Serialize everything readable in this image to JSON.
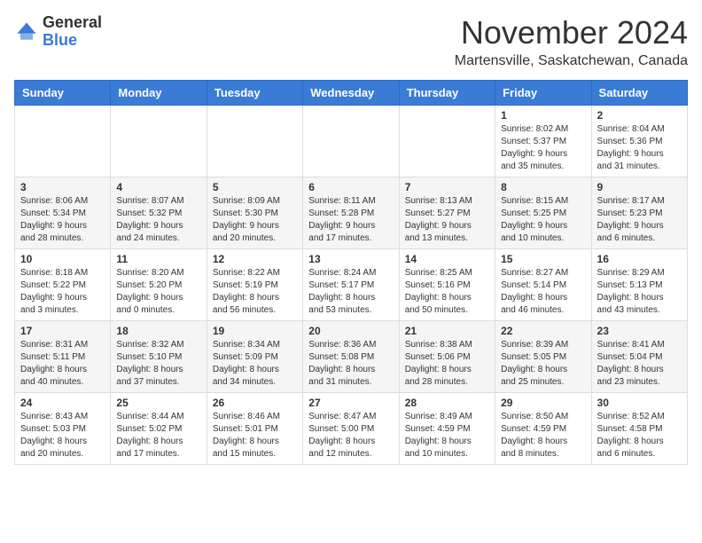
{
  "header": {
    "logo_general": "General",
    "logo_blue": "Blue",
    "month": "November 2024",
    "location": "Martensville, Saskatchewan, Canada"
  },
  "weekdays": [
    "Sunday",
    "Monday",
    "Tuesday",
    "Wednesday",
    "Thursday",
    "Friday",
    "Saturday"
  ],
  "weeks": [
    [
      {
        "day": "",
        "info": ""
      },
      {
        "day": "",
        "info": ""
      },
      {
        "day": "",
        "info": ""
      },
      {
        "day": "",
        "info": ""
      },
      {
        "day": "",
        "info": ""
      },
      {
        "day": "1",
        "info": "Sunrise: 8:02 AM\nSunset: 5:37 PM\nDaylight: 9 hours\nand 35 minutes."
      },
      {
        "day": "2",
        "info": "Sunrise: 8:04 AM\nSunset: 5:36 PM\nDaylight: 9 hours\nand 31 minutes."
      }
    ],
    [
      {
        "day": "3",
        "info": "Sunrise: 8:06 AM\nSunset: 5:34 PM\nDaylight: 9 hours\nand 28 minutes."
      },
      {
        "day": "4",
        "info": "Sunrise: 8:07 AM\nSunset: 5:32 PM\nDaylight: 9 hours\nand 24 minutes."
      },
      {
        "day": "5",
        "info": "Sunrise: 8:09 AM\nSunset: 5:30 PM\nDaylight: 9 hours\nand 20 minutes."
      },
      {
        "day": "6",
        "info": "Sunrise: 8:11 AM\nSunset: 5:28 PM\nDaylight: 9 hours\nand 17 minutes."
      },
      {
        "day": "7",
        "info": "Sunrise: 8:13 AM\nSunset: 5:27 PM\nDaylight: 9 hours\nand 13 minutes."
      },
      {
        "day": "8",
        "info": "Sunrise: 8:15 AM\nSunset: 5:25 PM\nDaylight: 9 hours\nand 10 minutes."
      },
      {
        "day": "9",
        "info": "Sunrise: 8:17 AM\nSunset: 5:23 PM\nDaylight: 9 hours\nand 6 minutes."
      }
    ],
    [
      {
        "day": "10",
        "info": "Sunrise: 8:18 AM\nSunset: 5:22 PM\nDaylight: 9 hours\nand 3 minutes."
      },
      {
        "day": "11",
        "info": "Sunrise: 8:20 AM\nSunset: 5:20 PM\nDaylight: 9 hours\nand 0 minutes."
      },
      {
        "day": "12",
        "info": "Sunrise: 8:22 AM\nSunset: 5:19 PM\nDaylight: 8 hours\nand 56 minutes."
      },
      {
        "day": "13",
        "info": "Sunrise: 8:24 AM\nSunset: 5:17 PM\nDaylight: 8 hours\nand 53 minutes."
      },
      {
        "day": "14",
        "info": "Sunrise: 8:25 AM\nSunset: 5:16 PM\nDaylight: 8 hours\nand 50 minutes."
      },
      {
        "day": "15",
        "info": "Sunrise: 8:27 AM\nSunset: 5:14 PM\nDaylight: 8 hours\nand 46 minutes."
      },
      {
        "day": "16",
        "info": "Sunrise: 8:29 AM\nSunset: 5:13 PM\nDaylight: 8 hours\nand 43 minutes."
      }
    ],
    [
      {
        "day": "17",
        "info": "Sunrise: 8:31 AM\nSunset: 5:11 PM\nDaylight: 8 hours\nand 40 minutes."
      },
      {
        "day": "18",
        "info": "Sunrise: 8:32 AM\nSunset: 5:10 PM\nDaylight: 8 hours\nand 37 minutes."
      },
      {
        "day": "19",
        "info": "Sunrise: 8:34 AM\nSunset: 5:09 PM\nDaylight: 8 hours\nand 34 minutes."
      },
      {
        "day": "20",
        "info": "Sunrise: 8:36 AM\nSunset: 5:08 PM\nDaylight: 8 hours\nand 31 minutes."
      },
      {
        "day": "21",
        "info": "Sunrise: 8:38 AM\nSunset: 5:06 PM\nDaylight: 8 hours\nand 28 minutes."
      },
      {
        "day": "22",
        "info": "Sunrise: 8:39 AM\nSunset: 5:05 PM\nDaylight: 8 hours\nand 25 minutes."
      },
      {
        "day": "23",
        "info": "Sunrise: 8:41 AM\nSunset: 5:04 PM\nDaylight: 8 hours\nand 23 minutes."
      }
    ],
    [
      {
        "day": "24",
        "info": "Sunrise: 8:43 AM\nSunset: 5:03 PM\nDaylight: 8 hours\nand 20 minutes."
      },
      {
        "day": "25",
        "info": "Sunrise: 8:44 AM\nSunset: 5:02 PM\nDaylight: 8 hours\nand 17 minutes."
      },
      {
        "day": "26",
        "info": "Sunrise: 8:46 AM\nSunset: 5:01 PM\nDaylight: 8 hours\nand 15 minutes."
      },
      {
        "day": "27",
        "info": "Sunrise: 8:47 AM\nSunset: 5:00 PM\nDaylight: 8 hours\nand 12 minutes."
      },
      {
        "day": "28",
        "info": "Sunrise: 8:49 AM\nSunset: 4:59 PM\nDaylight: 8 hours\nand 10 minutes."
      },
      {
        "day": "29",
        "info": "Sunrise: 8:50 AM\nSunset: 4:59 PM\nDaylight: 8 hours\nand 8 minutes."
      },
      {
        "day": "30",
        "info": "Sunrise: 8:52 AM\nSunset: 4:58 PM\nDaylight: 8 hours\nand 6 minutes."
      }
    ]
  ]
}
